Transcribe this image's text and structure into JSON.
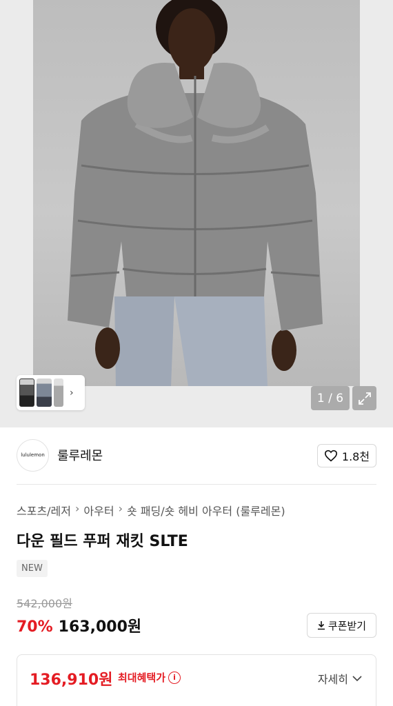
{
  "gallery": {
    "counter": "1 / 6"
  },
  "brand": {
    "logo_text": "lululemon",
    "name": "룰루레몬",
    "likes": "1.8천"
  },
  "breadcrumb": [
    "스포츠/레저",
    "아우터",
    "숏 패딩/숏 헤비 아우터 (룰루레몬)"
  ],
  "product": {
    "title": "다운 필드 푸퍼 재킷 SLTE",
    "badge": "NEW",
    "original_price": "542,000원",
    "discount": "70%",
    "sale_price": "163,000원"
  },
  "coupon": {
    "label": "쿠폰받기"
  },
  "benefit": {
    "price": "136,910원",
    "label": "최대혜택가",
    "detail_label": "자세히"
  },
  "colors": {
    "accent_red": "#e41c23"
  }
}
